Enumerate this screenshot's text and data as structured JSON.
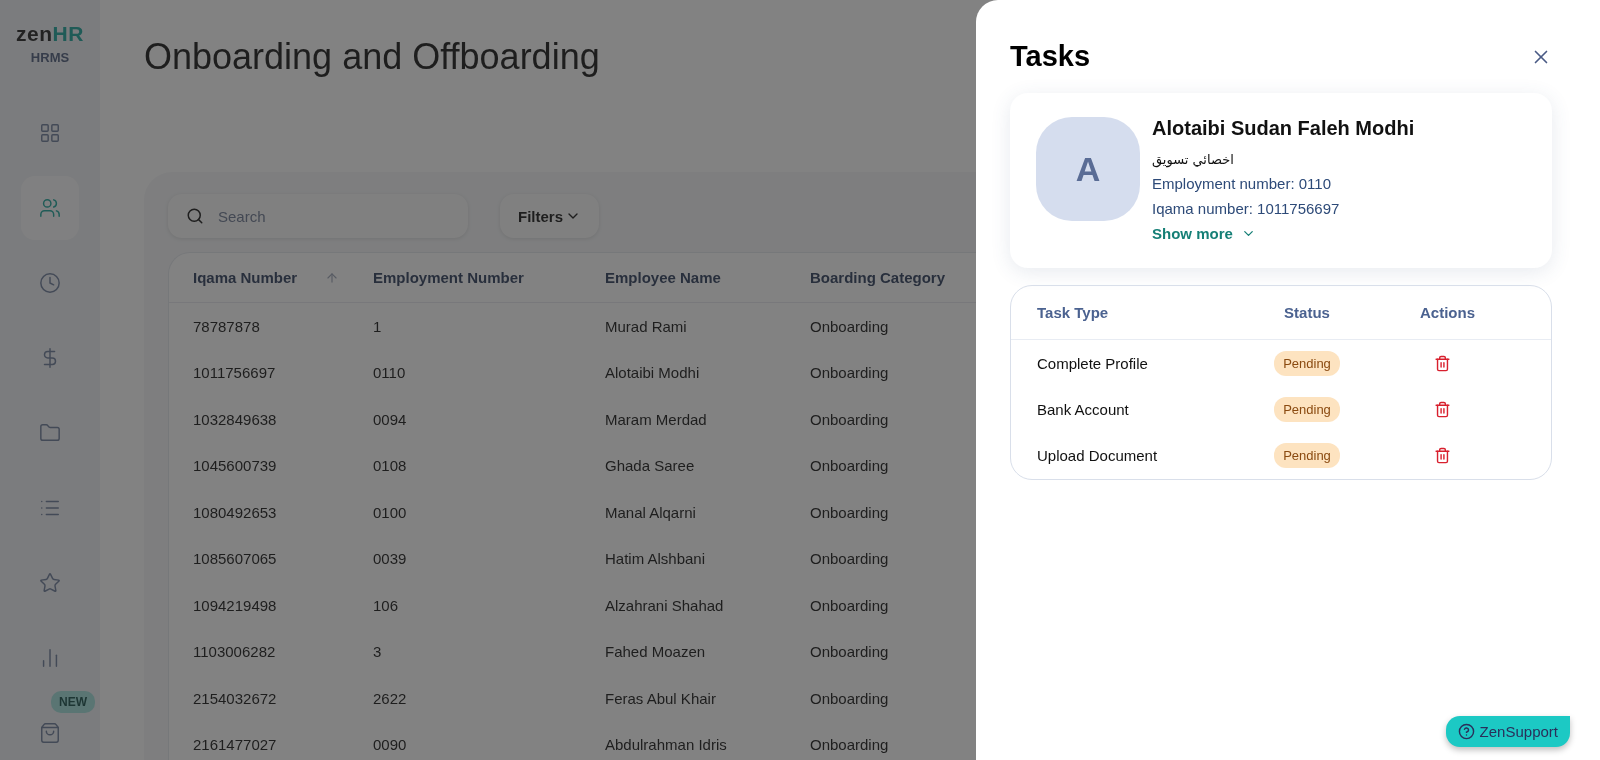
{
  "logo": {
    "brand_a": "zen",
    "brand_b": "HR",
    "product": "HRMS"
  },
  "sidebar": {
    "items": [
      {
        "kind": "grid",
        "selected": false
      },
      {
        "kind": "users",
        "selected": true
      },
      {
        "kind": "clock",
        "selected": false
      },
      {
        "kind": "dollar",
        "selected": false
      },
      {
        "kind": "folder",
        "selected": false
      },
      {
        "kind": "list",
        "selected": false
      },
      {
        "kind": "star",
        "selected": false
      },
      {
        "kind": "chart",
        "selected": false
      },
      {
        "kind": "bag",
        "selected": false,
        "badge": "NEW"
      }
    ]
  },
  "page": {
    "title": "Onboarding and Offboarding"
  },
  "search": {
    "placeholder": "Search"
  },
  "filters_button": "Filters",
  "table": {
    "columns": [
      "Iqama Number",
      "Employment Number",
      "Employee Name",
      "Boarding Category"
    ],
    "rows": [
      [
        "78787878",
        "1",
        "Murad Rami",
        "Onboarding"
      ],
      [
        "1011756697",
        "0110",
        "Alotaibi Modhi",
        "Onboarding"
      ],
      [
        "1032849638",
        "0094",
        "Maram Merdad",
        "Onboarding"
      ],
      [
        "1045600739",
        "0108",
        "Ghada Saree",
        "Onboarding"
      ],
      [
        "1080492653",
        "0100",
        "Manal Alqarni",
        "Onboarding"
      ],
      [
        "1085607065",
        "0039",
        "Hatim Alshbani",
        "Onboarding"
      ],
      [
        "1094219498",
        "106",
        "Alzahrani Shahad",
        "Onboarding"
      ],
      [
        "1103006282",
        "3",
        "Fahed Moazen",
        "Onboarding"
      ],
      [
        "2154032672",
        "2622",
        "Feras Abul Khair",
        "Onboarding"
      ],
      [
        "2161477027",
        "0090",
        "Abdulrahman Idris",
        "Onboarding"
      ]
    ]
  },
  "drawer": {
    "title": "Tasks",
    "profile": {
      "initial": "A",
      "name": "Alotaibi Sudan Faleh Modhi",
      "job_title": "اخصائي تسويق",
      "employment_number": "Employment number: 0110",
      "iqama_number": "Iqama number: 1011756697",
      "show_more": "Show more"
    },
    "tasks": {
      "columns": [
        "Task Type",
        "Status",
        "Actions"
      ],
      "rows": [
        {
          "task_type": "Complete Profile",
          "status": "Pending"
        },
        {
          "task_type": "Bank Account",
          "status": "Pending"
        },
        {
          "task_type": "Upload Document",
          "status": "Pending"
        }
      ]
    }
  },
  "support_button": "ZenSupport"
}
